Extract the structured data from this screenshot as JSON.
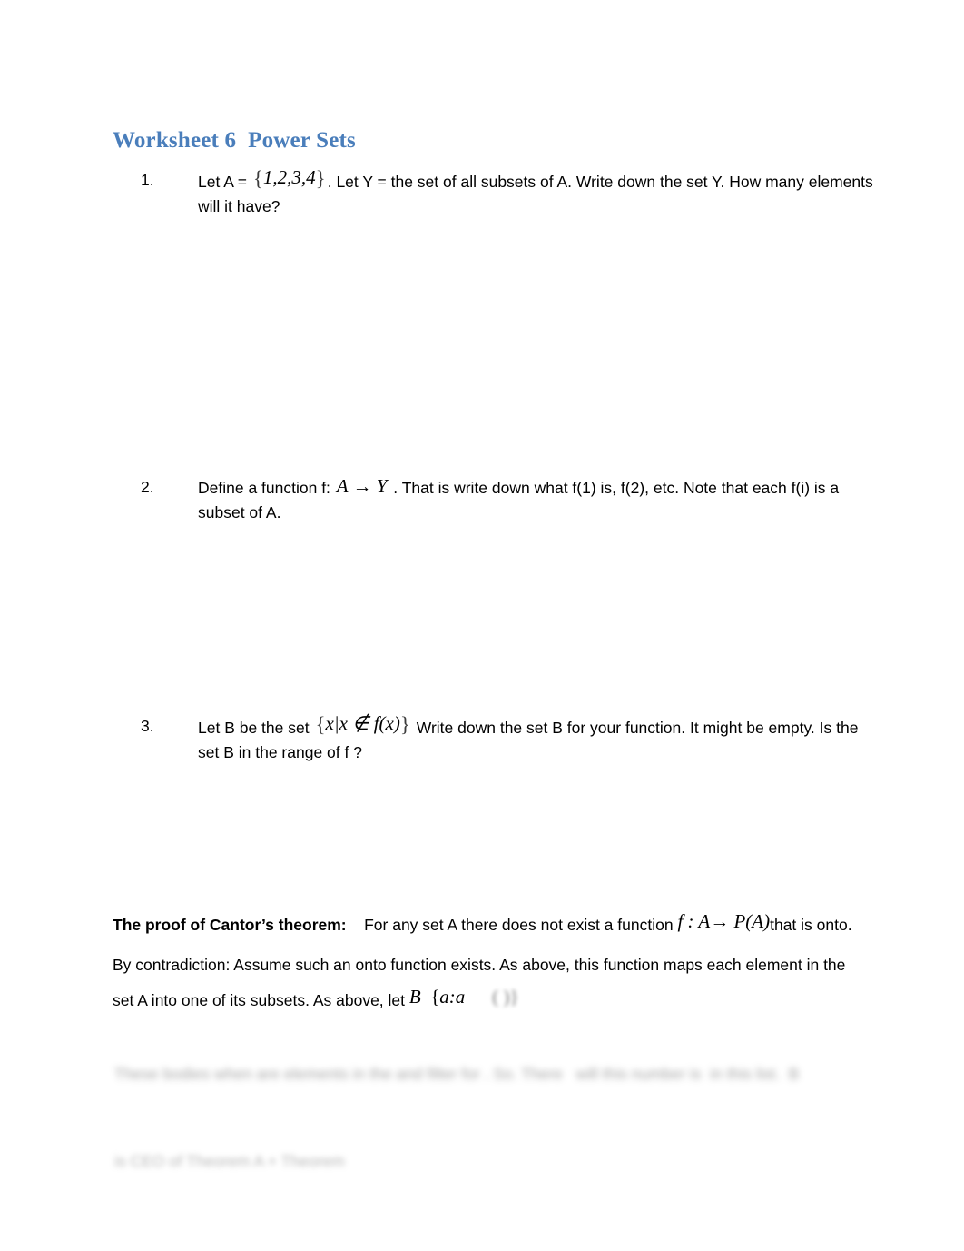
{
  "document": {
    "title": "Worksheet 6  Power Sets",
    "title_color": "#4a7ebb",
    "background_color": "#ffffff",
    "text_color": "#000000"
  },
  "questions": [
    {
      "number": "1.",
      "text_before_math": "Let A = ",
      "math": "{1,2,3,4}",
      "math_open": "{",
      "math_body": "1,2,3,4",
      "math_close": "}",
      "text_after_math": ".  Let Y = the set of all subsets of A.  Write down the set Y.  How many elements will it have?"
    },
    {
      "number": "2.",
      "text_before_math": "Define a function f: ",
      "math": "A → Y",
      "text_after_math": " .  That is write down what f(1) is, f(2), etc.  Note that each f(i) is a subset of A."
    },
    {
      "number": "3.",
      "text_before_math": "Let B be the set ",
      "math": "{x|x ∉ f(x)}",
      "math_open": "{",
      "math_body": "x|x ∉ f(x)",
      "math_close": "}",
      "text_after_math": "  Write down the set B for your function.  It might be empty.  Is the set B in the range of f ?"
    }
  ],
  "proof": {
    "heading": "The proof of Cantor’s theorem:",
    "line1_before_math": "For any set A there does not exist a function ",
    "line1_math": "f : A→ P(A)",
    "line1_after_math": "that is onto.",
    "line2": "By contradiction:  Assume such an onto function exists.  As above, this function maps each element in the set A into one of its subsets.   As above, let ",
    "line2_math_prefix": "B",
    "line2_math_open": "{",
    "line2_math_body": "a:a",
    "line2_math_tail": "( )}"
  },
  "redacted": {
    "line1": "These bodies when are elements in the and filter for . So. There   will this number is  in this list.  B",
    "line2": "is CEO of Theorem A + Theorem"
  }
}
